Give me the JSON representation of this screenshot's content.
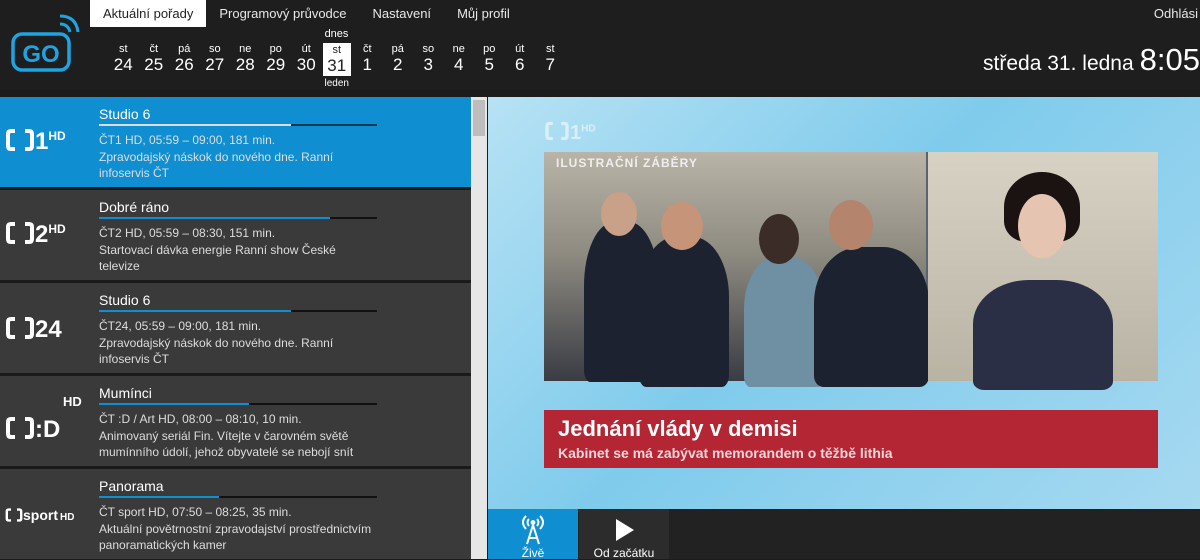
{
  "nav": {
    "tabs": [
      "Aktuální pořady",
      "Programový průvodce",
      "Nastavení",
      "Můj profil"
    ],
    "logout": "Odhlási"
  },
  "logo_text": "GO",
  "dates": {
    "before": [
      {
        "day": "st",
        "num": "24"
      },
      {
        "day": "čt",
        "num": "25"
      },
      {
        "day": "pá",
        "num": "26"
      },
      {
        "day": "so",
        "num": "27"
      },
      {
        "day": "ne",
        "num": "28"
      },
      {
        "day": "po",
        "num": "29"
      },
      {
        "day": "út",
        "num": "30"
      }
    ],
    "today": {
      "label": "dnes",
      "day": "st",
      "num": "31",
      "month": "leden"
    },
    "after": [
      {
        "day": "čt",
        "num": "1"
      },
      {
        "day": "pá",
        "num": "2"
      },
      {
        "day": "so",
        "num": "3"
      },
      {
        "day": "ne",
        "num": "4"
      },
      {
        "day": "po",
        "num": "5"
      },
      {
        "day": "út",
        "num": "6"
      },
      {
        "day": "st",
        "num": "7"
      }
    ]
  },
  "clock": {
    "date": "středa 31. ledna",
    "time": "8:05"
  },
  "channels": [
    {
      "logo": "1",
      "logo_hd": "HD",
      "title": "Studio 6",
      "meta": "ČT1 HD, 05:59 – 09:00, 181 min.",
      "desc": "Zpravodajský náskok do nového dne. Ranní infoservis ČT",
      "progress": 0.69,
      "active": true
    },
    {
      "logo": "2",
      "logo_hd": "HD",
      "title": "Dobré ráno",
      "meta": "ČT2 HD, 05:59 – 08:30, 151 min.",
      "desc": "Startovací dávka energie Ranní show České televize",
      "progress": 0.83,
      "active": false
    },
    {
      "logo": "24",
      "logo_hd": "",
      "title": "Studio 6",
      "meta": "ČT24, 05:59 – 09:00, 181 min.",
      "desc": "Zpravodajský náskok do nového dne. Ranní infoservis ČT",
      "progress": 0.69,
      "active": false
    },
    {
      "logo": ":D",
      "logo_hd": "HD",
      "title": "Mumínci",
      "meta": "ČT :D / Art HD, 08:00 – 08:10, 10 min.",
      "desc": "Animovaný seriál Fin. Vítejte v čarovném světě mumínního údolí, jehož obyvatelé se nebojí snít",
      "progress": 0.54,
      "active": false
    },
    {
      "logo": "sport",
      "logo_hd": "HD",
      "title": "Panorama",
      "meta": "ČT sport HD, 07:50 – 08:25, 35 min.",
      "desc": "Aktuální povětrnostní zpravodajství prostřednictvím panoramatických kamer",
      "progress": 0.43,
      "active": false
    }
  ],
  "video": {
    "channel_logo": "1",
    "channel_hd": "HD",
    "stamp": "ILUSTRAČNÍ ZÁBĚRY",
    "headline": "Jednání vlády v demisi",
    "subline": "Kabinet se má zabývat memorandem o těžbě lithia"
  },
  "controls": {
    "live": "Živě",
    "start": "Od začátku"
  },
  "colors": {
    "accent": "#0f8fd1",
    "lower_third": "#b52634"
  }
}
